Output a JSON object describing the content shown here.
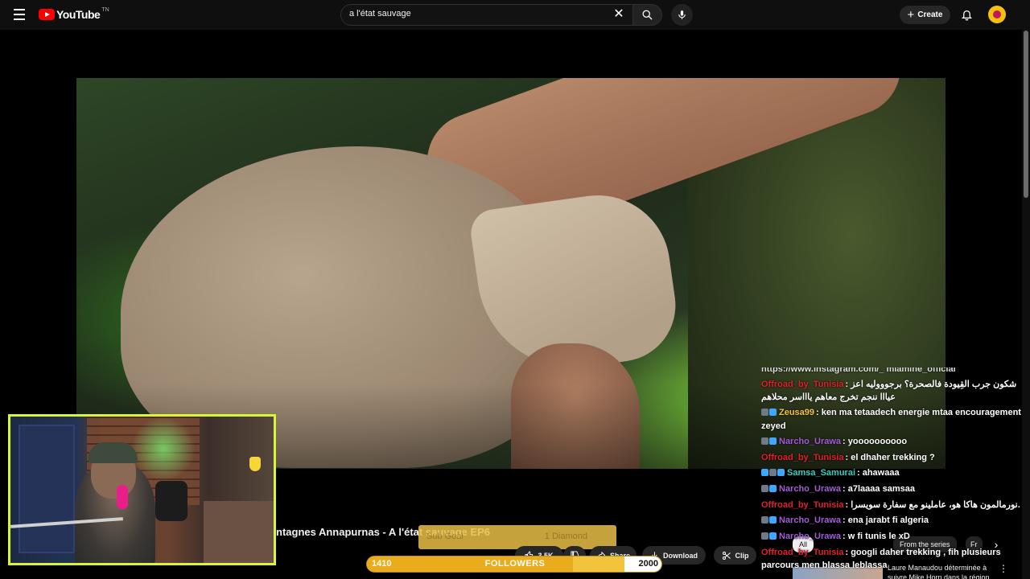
{
  "header": {
    "logo_text": "YouTube",
    "logo_region": "TN",
    "search": {
      "value": "a l'état sauvage",
      "placeholder": "Search"
    },
    "create_label": "Create",
    "accent": "#ff0000"
  },
  "video": {
    "title": "ntagnes Annapurnas - A l'état sauvage EP6",
    "sub_goal": {
      "left": "Sub Goal",
      "right": "1 Diamond"
    },
    "actions": {
      "like": "3.5K",
      "share": "Share",
      "download": "Download",
      "clip": "Clip"
    }
  },
  "followers_goal": {
    "label": "FOLLOWERS",
    "current": "1410",
    "target": "2000",
    "progress": 0.705
  },
  "chat": [
    {
      "user": "",
      "text": "https://www.instagram.com/_ mlamine_official",
      "color": "#ffffff",
      "badges": []
    },
    {
      "user": "Offroad_by_Tunisia",
      "text": ": شكون جرب القِيودة فالصحرة؟ برجوووليه اعز عيااا ننجم تخرج معاهم ياااسر محلاهم",
      "color": "#e0202a",
      "badges": []
    },
    {
      "user": "Zeusa99",
      "text": ": ken ma tetaadech energie mtaa encouragement zeyed",
      "color": "#f5c542",
      "badges": [
        "#6e7a88",
        "#3ea7ff"
      ]
    },
    {
      "user": "Narcho_Urawa",
      "text": ": yoooooooooo",
      "color": "#a35bd8",
      "badges": [
        "#6e7a88",
        "#3ea7ff"
      ]
    },
    {
      "user": "Offroad_by_Tunisia",
      "text": ": el dhaher trekking ?",
      "color": "#e0202a",
      "badges": []
    },
    {
      "user": "Samsa_Samurai",
      "text": ": ahawaaa",
      "color": "#2fd2c5",
      "badges": [
        "#3ea7ff",
        "#6e7a88",
        "#3ea7ff"
      ]
    },
    {
      "user": "Narcho_Urawa",
      "text": ": a7laaaa samsaa",
      "color": "#a35bd8",
      "badges": [
        "#6e7a88",
        "#3ea7ff"
      ]
    },
    {
      "user": "Offroad_by_Tunisia",
      "text": ": نورمالمون هاكا هو، عاملينو مع سفارة سويسرا.",
      "color": "#e0202a",
      "badges": []
    },
    {
      "user": "Narcho_Urawa",
      "text": ": ena jarabt fi algeria",
      "color": "#a35bd8",
      "badges": [
        "#6e7a88",
        "#3ea7ff"
      ]
    },
    {
      "user": "Narcho_Urawa",
      "text": ": w fi tunis le xD",
      "color": "#a35bd8",
      "badges": [
        "#6e7a88",
        "#3ea7ff"
      ]
    },
    {
      "user": "Offroad_by_Tunisia",
      "text": ": googli daher trekking , fih plusieurs parcours men blassa leblassa",
      "color": "#e0202a",
      "badges": []
    }
  ],
  "chips": {
    "first": "All",
    "second": "From the series",
    "third": "Fr"
  },
  "recommendation": {
    "title": "Laure Manaudou déterminée à suivre Mike Horn dans la région"
  },
  "icons": {
    "menu": "menu-icon",
    "logo": "youtube-logo-icon",
    "clear": "close-icon",
    "search": "search-icon",
    "mic": "mic-icon",
    "create": "plus-icon",
    "bell": "bell-icon",
    "like": "thumbs-up-icon",
    "dislike": "thumbs-down-icon",
    "share": "share-icon",
    "download": "download-icon",
    "clip": "scissors-icon",
    "more": "more-vert-icon",
    "chevron": "chevron-right-icon"
  }
}
